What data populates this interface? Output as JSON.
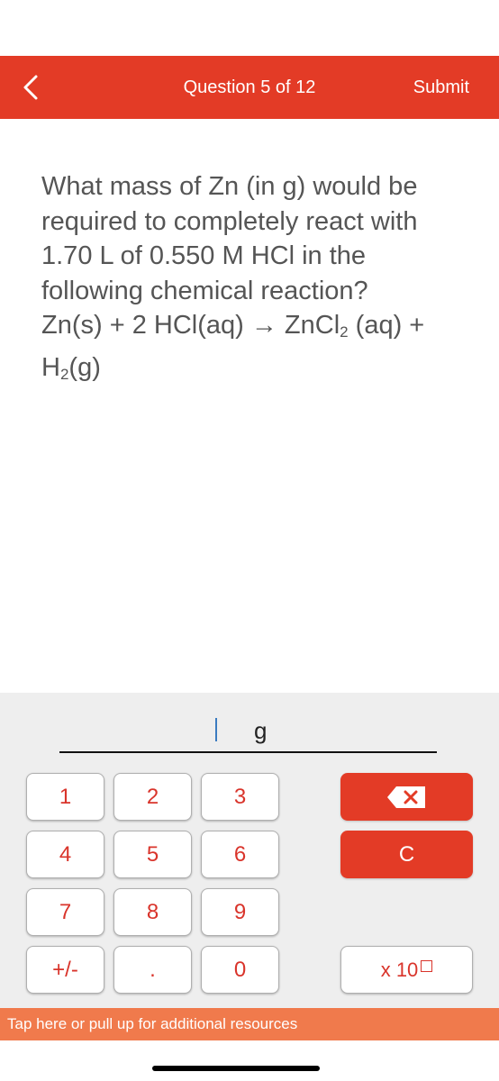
{
  "header": {
    "back_icon": "chevron-left-icon",
    "title": "Question 5 of 12",
    "submit_label": "Submit",
    "bar_color": "#E33B26"
  },
  "question": {
    "line1": "What mass of Zn (in g) would be required to completely react with 1.70 L of 0.550 M HCl in the following chemical reaction?",
    "equation_part1": "Zn(s) + 2 HCl(aq) → ZnCl",
    "equation_sub1": "2",
    "equation_part2": " (aq) + H",
    "equation_sub2": "2",
    "equation_part3": "(g)"
  },
  "answer": {
    "value": "",
    "unit": "g"
  },
  "keypad": {
    "keys": [
      "1",
      "2",
      "3",
      "4",
      "5",
      "6",
      "7",
      "8",
      "9",
      "+/-",
      ".",
      "0"
    ],
    "backspace_icon": "backspace-icon",
    "clear_label": "C",
    "exponent_label": "x 10",
    "exponent_box_icon": "empty-box-icon",
    "accent_color": "#E33B26"
  },
  "resources_bar": {
    "label": "Tap here or pull up for additional resources",
    "color": "#F07A4C"
  }
}
